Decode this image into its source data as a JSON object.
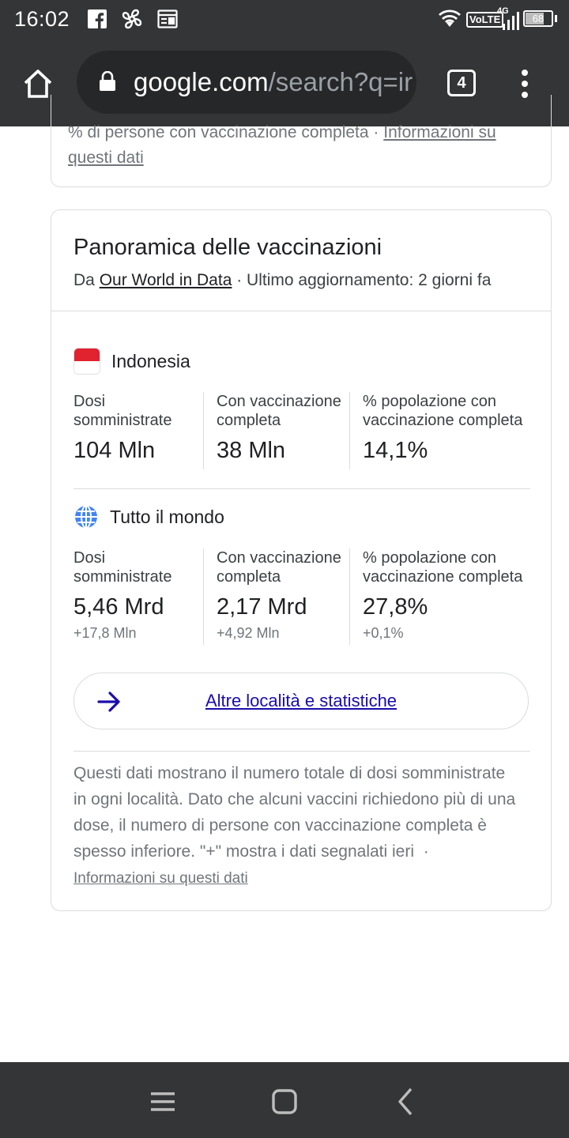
{
  "status_bar": {
    "time": "16:02",
    "volte": "VoLTE",
    "network": "4G",
    "battery": "68",
    "battery_level": 0.68
  },
  "toolbar": {
    "url_domain": "google.com",
    "url_rest": "/search?q=ir",
    "tab_count": "4"
  },
  "prev_card": {
    "text": "% di persone con vaccinazione completa",
    "separator": "·",
    "link": "Informazioni su questi dati"
  },
  "card": {
    "title": "Panoramica delle vaccinazioni",
    "source_prefix": "Da",
    "source_link": "Our World in Data",
    "source_suffix": "· Ultimo aggiornamento: 2 giorni fa",
    "locations": [
      {
        "name": "Indonesia",
        "icon": "indonesia-flag-icon",
        "stats": [
          {
            "label": "Dosi somministrate",
            "value": "104 Mln",
            "delta": ""
          },
          {
            "label": "Con vaccinazione completa",
            "value": "38 Mln",
            "delta": ""
          },
          {
            "label": "% popolazione con vaccinazione completa",
            "value": "14,1%",
            "delta": ""
          }
        ]
      },
      {
        "name": "Tutto il mondo",
        "icon": "globe-icon",
        "stats": [
          {
            "label": "Dosi somministrate",
            "value": "5,46 Mrd",
            "delta": "+17,8 Mln"
          },
          {
            "label": "Con vaccinazione completa",
            "value": "2,17 Mrd",
            "delta": "+4,92 Mln"
          },
          {
            "label": "% popolazione con vaccinazione completa",
            "value": "27,8%",
            "delta": "+0,1%"
          }
        ]
      }
    ],
    "more_button": "Altre località e statistiche",
    "note": "Questi dati mostrano il numero totale di dosi somministrate in ogni località. Dato che alcuni vaccini richiedono più di una dose, il numero di persone con vaccinazione completa è spesso inferiore. \"+\" mostra i dati segnalati ieri",
    "note_separator": "·",
    "note_link": "Informazioni su questi dati"
  },
  "colors": {
    "chrome": "#343537",
    "link": "#1a0dab",
    "flag_red": "#e1222f",
    "globe_blue": "#4285f4"
  }
}
